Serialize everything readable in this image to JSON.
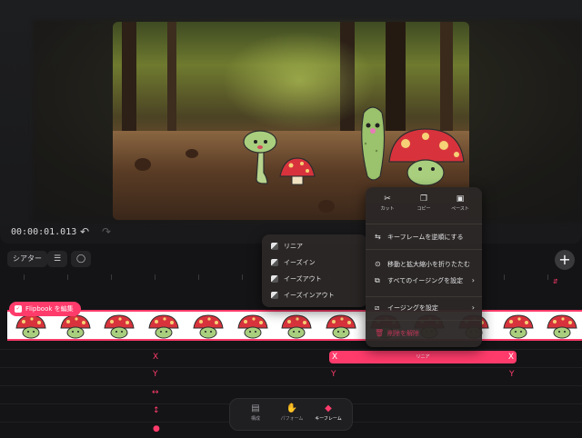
{
  "player": {
    "timecode": "00:00:01.013",
    "undo_icon": "undo-icon",
    "redo_icon": "redo-icon"
  },
  "toolbar": {
    "theater_label": "シアター",
    "icons": [
      "layers-icon",
      "comment-icon"
    ],
    "add_icon": "plus-icon"
  },
  "track": {
    "flipbook_label": "Flipbook を編集",
    "frame_count": 13
  },
  "keyframes": {
    "rows": [
      {
        "label": "X",
        "icon": "x-axis"
      },
      {
        "label": "Y",
        "icon": "y-axis"
      },
      {
        "label": "↔",
        "icon": "scale-x-icon"
      },
      {
        "label": "↕",
        "icon": "scale-y-icon"
      }
    ],
    "ease_bar_label": "リニア",
    "x_marker": "X",
    "y_marker": "Y"
  },
  "easing_menu": {
    "items": [
      "リニア",
      "イーズイン",
      "イーズアウト",
      "イーズインアウト"
    ]
  },
  "context_menu": {
    "top": [
      {
        "label": "カット",
        "icon": "scissors-icon"
      },
      {
        "label": "コピー",
        "icon": "copy-icon"
      },
      {
        "label": "ペースト",
        "icon": "paste-icon"
      }
    ],
    "items": [
      {
        "label": "キーフレームを逆順にする",
        "icon": "reverse-icon"
      },
      {
        "label": "移動と拡大縮小を折りたたむ",
        "icon": "collapse-icon"
      },
      {
        "label": "すべてのイージングを設定",
        "icon": "easing-all-icon",
        "submenu": true
      },
      {
        "label": "イージングを設定",
        "icon": "easing-icon",
        "submenu": true
      },
      {
        "label": "削除を解除",
        "icon": "trash-icon",
        "danger": true
      }
    ]
  },
  "modes": {
    "items": [
      {
        "label": "構成",
        "icon": "compose-icon"
      },
      {
        "label": "パフォーム",
        "icon": "hand-icon"
      },
      {
        "label": "キーフレーム",
        "icon": "keyframe-icon",
        "active": true
      }
    ]
  },
  "colors": {
    "accent": "#ff3b6b",
    "bg": "#141416",
    "menu": "#2c2826"
  }
}
